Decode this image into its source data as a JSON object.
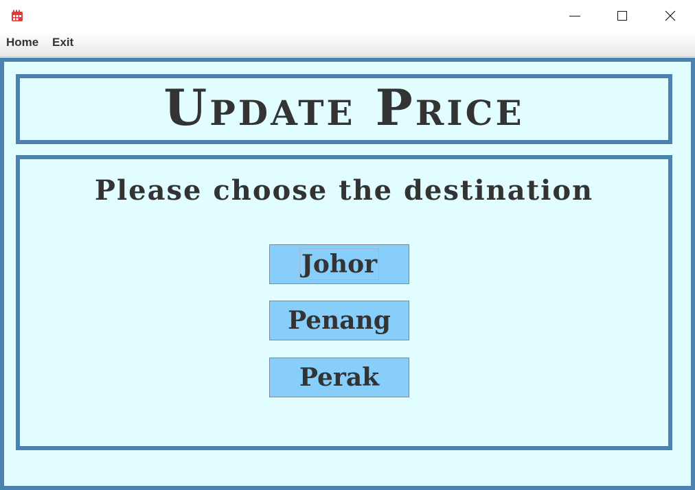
{
  "window": {
    "app_icon": "calendar-icon",
    "controls": {
      "minimize": "minimize-icon",
      "maximize": "maximize-icon",
      "close": "close-icon"
    }
  },
  "menu": {
    "home": "Home",
    "exit": "Exit"
  },
  "header": {
    "title": "Update Price"
  },
  "main": {
    "prompt": "Please choose the destination",
    "destinations": [
      {
        "label": "Johor"
      },
      {
        "label": "Penang"
      },
      {
        "label": "Perak"
      }
    ],
    "focused": "Johor"
  },
  "colors": {
    "border_accent": "#4a82b0",
    "panel_background": "#e2fdff",
    "button_background": "#87cefa",
    "text": "#333333",
    "app_icon": "#e53935"
  }
}
